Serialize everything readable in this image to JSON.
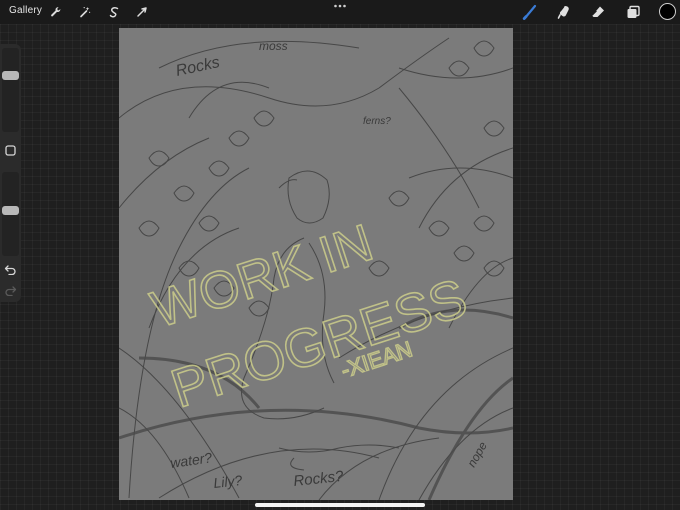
{
  "topbar": {
    "gallery_label": "Gallery",
    "left_tools": [
      "wrench-icon",
      "magic-wand-icon",
      "selection-icon",
      "transform-icon"
    ],
    "right_tools": [
      "brush-icon",
      "smudge-icon",
      "eraser-icon",
      "layers-icon"
    ],
    "active_tool": "brush-icon",
    "active_tool_color": "#3a7bd5",
    "current_color": "#000000"
  },
  "sidebar": {
    "brush_size_level": 0.7,
    "opacity_level": 0.55
  },
  "canvas": {
    "background": "#7b7b7b",
    "overlay_color": "#c8c98a",
    "watermark_line1": "WORK IN",
    "watermark_line2": "PROGRESS",
    "watermark_signature": "-XIEAN",
    "notes": {
      "moss": "moss",
      "rocks_top": "Rocks",
      "ferns": "ferns?",
      "water": "water?",
      "lily": "Lily?",
      "rocks_bottom": "Rocks?",
      "nope": "nope"
    }
  }
}
